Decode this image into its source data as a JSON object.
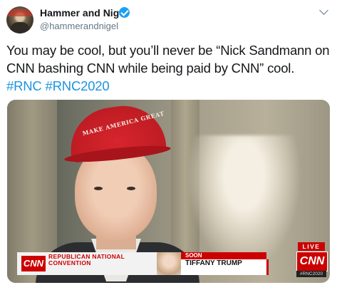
{
  "tweet": {
    "display_name": "Hammer and Nigel",
    "handle": "@hammerandnigel",
    "verified": true,
    "text_before": "You may be cool, but you’ll never be “Nick Sandmann on CNN bashing CNN while being paid by CNN” cool. ",
    "hashtags": [
      "#RNC",
      "#RNC2020"
    ]
  },
  "media": {
    "hat_text": "MAKE AMERICA GREAT",
    "lower_third": {
      "network_logo": "CNN",
      "event_label": "REPUBLICAN NATIONAL CONVENTION",
      "soon_label": "SOON",
      "speaker_name": "TIFFANY TRUMP"
    },
    "live_label": "LIVE",
    "corner_logo": "CNN",
    "corner_tag": "#RNC2020"
  },
  "colors": {
    "hashtag": "#1b95e0",
    "verified": "#1da1f2",
    "cnn_red": "#cc0000"
  }
}
